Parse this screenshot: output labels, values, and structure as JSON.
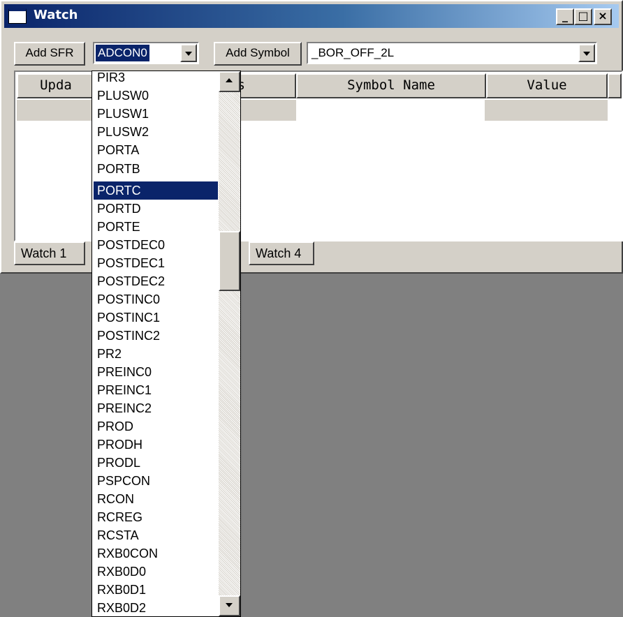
{
  "window": {
    "title": "Watch",
    "controls": {
      "minimize": "_",
      "maximize": "□",
      "close": "×"
    }
  },
  "toolbar": {
    "add_sfr_label": "Add SFR",
    "sfr_value": "ADCON0",
    "add_symbol_label": "Add Symbol",
    "symbol_value": "_BOR_OFF_2L"
  },
  "table": {
    "columns": [
      "Upda",
      "ss",
      "Symbol Name",
      "Value"
    ]
  },
  "tabs": [
    "Watch 1",
    "Watch 4"
  ],
  "dropdown": {
    "items": [
      "PIR3",
      "PLUSW0",
      "PLUSW1",
      "PLUSW2",
      "PORTA",
      "PORTB",
      "PORTC",
      "PORTD",
      "PORTE",
      "POSTDEC0",
      "POSTDEC1",
      "POSTDEC2",
      "POSTINC0",
      "POSTINC1",
      "POSTINC2",
      "PR2",
      "PREINC0",
      "PREINC1",
      "PREINC2",
      "PROD",
      "PRODH",
      "PRODL",
      "PSPCON",
      "RCON",
      "RCREG",
      "RCSTA",
      "RXB0CON",
      "RXB0D0",
      "RXB0D1",
      "RXB0D2"
    ],
    "highlighted": "PORTC"
  },
  "colors": {
    "selection": "#0a246a",
    "face": "#d4d0c8",
    "desktop": "#808080"
  }
}
